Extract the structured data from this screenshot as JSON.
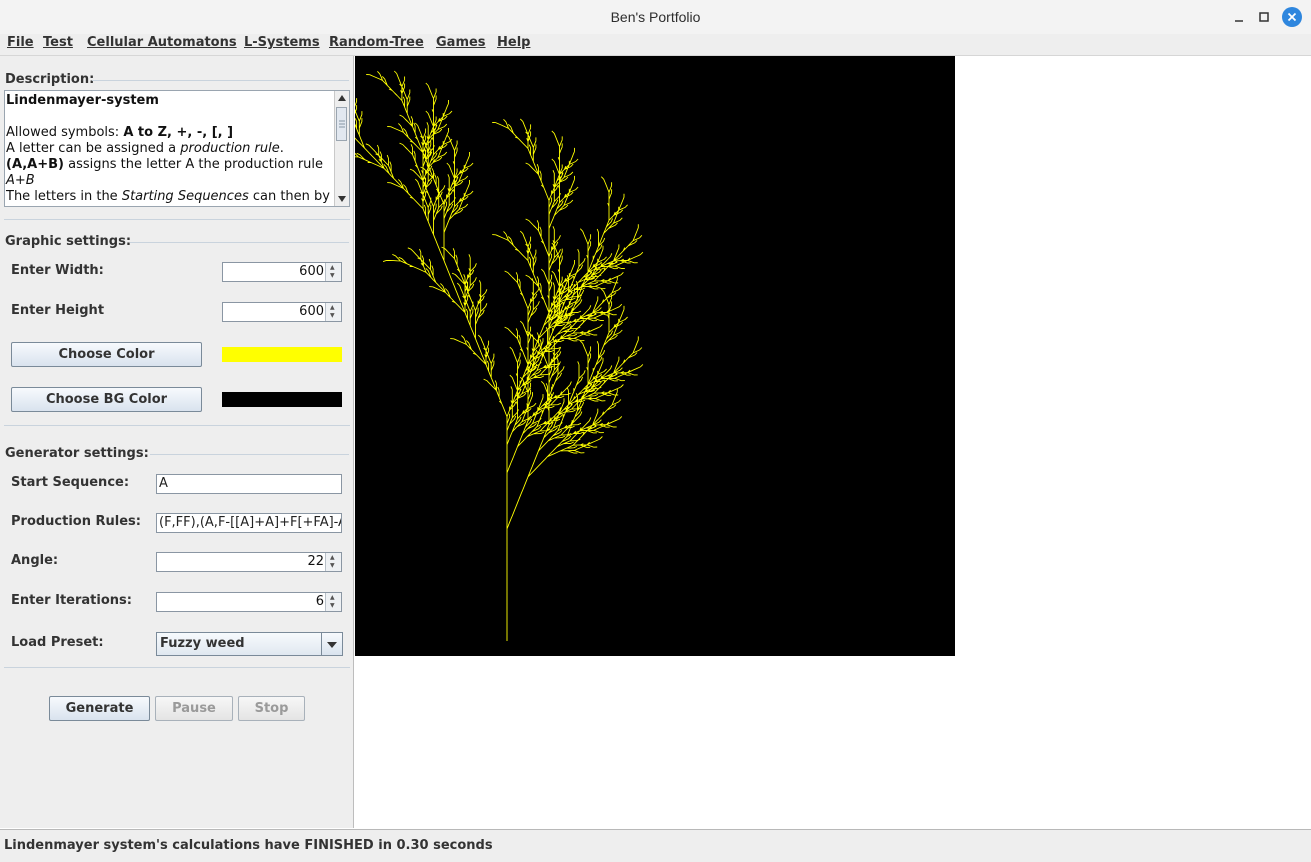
{
  "window": {
    "title": "Ben's Portfolio"
  },
  "menu": {
    "items": [
      "File",
      "Test",
      "Cellular Automatons",
      "L-Systems",
      "Random-Tree",
      "Games",
      "Help"
    ]
  },
  "description": {
    "section_title": "Description:",
    "heading": "Lindenmayer-system",
    "line2_prefix": "Allowed symbols: ",
    "line2_bold": "A to Z, +, -, [, ]",
    "line3_prefix": "A letter can be assigned a ",
    "line3_italic": "production rule",
    "line3_suffix": ".",
    "line4_bold": "(A,A+B)",
    "line4_suffix": " assigns the letter A the production rule",
    "line5_italic": "A+B",
    "line6_prefix": "The letters in the ",
    "line6_italic": "Starting Sequences",
    "line6_suffix": " can then by"
  },
  "graphic_settings": {
    "section_title": "Graphic settings:",
    "width_label": "Enter Width:",
    "width_value": "600",
    "height_label": "Enter Height",
    "height_value": "600",
    "choose_color_label": "Choose Color",
    "color": "#ffff00",
    "choose_bg_label": "Choose BG Color",
    "bg_color": "#000000"
  },
  "generator_settings": {
    "section_title": "Generator settings:",
    "start_label": "Start Sequence:",
    "start_value": "A",
    "rules_label": "Production Rules:",
    "rules_value": "(F,FF),(A,F-[[A]+A]+F[+FA]-A)",
    "angle_label": "Angle:",
    "angle_value": "22",
    "iterations_label": "Enter Iterations:",
    "iterations_value": "6",
    "preset_label": "Load Preset:",
    "preset_value": "Fuzzy weed"
  },
  "actions": {
    "generate_label": "Generate",
    "pause_label": "Pause",
    "stop_label": "Stop"
  },
  "lsystem": {
    "axiom": "A",
    "iterations": 6,
    "angle_deg": 22
  },
  "status": {
    "text": "Lindenmayer system's calculations have FINISHED in 0.30 seconds"
  }
}
